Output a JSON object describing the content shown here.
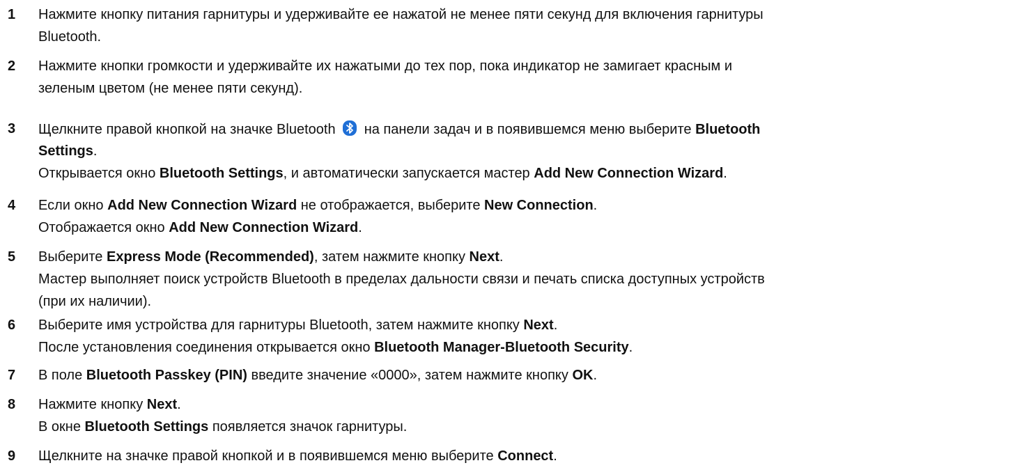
{
  "steps": [
    {
      "num": "1",
      "lines": [
        [
          {
            "t": "Нажмите кнопку питания гарнитуры и удерживайте ее нажатой не менее пяти секунд для включения гарнитуры"
          }
        ],
        [
          {
            "t": "Bluetooth."
          }
        ]
      ]
    },
    {
      "num": "2",
      "lines": [
        [
          {
            "t": "Нажмите кнопки громкости и удерживайте их нажатыми до тех пор, пока индикатор не замигает красным и"
          }
        ],
        [
          {
            "t": "зеленым цветом (не менее пяти секунд)."
          }
        ]
      ]
    },
    {
      "num": "3",
      "lines": [
        [
          {
            "t": "Щелкните правой кнопкой на значке Bluetooth "
          },
          {
            "icon": "bluetooth-icon"
          },
          {
            "t": " на панели задач и в появившемся меню выберите "
          },
          {
            "t": "Bluetooth",
            "b": true
          }
        ],
        [
          {
            "t": "Settings",
            "b": true
          },
          {
            "t": "."
          }
        ],
        [
          {
            "t": "Открывается окно "
          },
          {
            "t": "Bluetooth Settings",
            "b": true
          },
          {
            "t": ", и автоматически запускается мастер "
          },
          {
            "t": "Add New Connection Wizard",
            "b": true
          },
          {
            "t": "."
          }
        ]
      ]
    },
    {
      "num": "4",
      "lines": [
        [
          {
            "t": "Если окно "
          },
          {
            "t": "Add New Connection Wizard",
            "b": true
          },
          {
            "t": " не отображается, выберите "
          },
          {
            "t": "New Connection",
            "b": true
          },
          {
            "t": "."
          }
        ],
        [
          {
            "t": "Отображается окно "
          },
          {
            "t": "Add New Connection Wizard",
            "b": true
          },
          {
            "t": "."
          }
        ]
      ]
    },
    {
      "num": "5",
      "lines": [
        [
          {
            "t": "Выберите "
          },
          {
            "t": "Express Mode (Recommended)",
            "b": true
          },
          {
            "t": ", затем нажмите кнопку "
          },
          {
            "t": "Next",
            "b": true
          },
          {
            "t": "."
          }
        ],
        [
          {
            "t": "Мастер выполняет поиск устройств Bluetooth в пределах дальности связи и печать списка доступных устройств"
          }
        ],
        [
          {
            "t": "(при их наличии)."
          }
        ]
      ]
    },
    {
      "num": "6",
      "lines": [
        [
          {
            "t": "Выберите имя устройства для гарнитуры Bluetooth, затем нажмите кнопку "
          },
          {
            "t": "Next",
            "b": true
          },
          {
            "t": "."
          }
        ],
        [
          {
            "t": "После установления соединения открывается окно "
          },
          {
            "t": "Bluetooth Manager-Bluetooth Security",
            "b": true
          },
          {
            "t": "."
          }
        ]
      ]
    },
    {
      "num": "7",
      "lines": [
        [
          {
            "t": "В поле "
          },
          {
            "t": "Bluetooth Passkey (PIN)",
            "b": true
          },
          {
            "t": " введите значение «0000», затем нажмите кнопку "
          },
          {
            "t": "OK",
            "b": true
          },
          {
            "t": "."
          }
        ]
      ]
    },
    {
      "num": "8",
      "lines": [
        [
          {
            "t": "Нажмите кнопку "
          },
          {
            "t": "Next",
            "b": true
          },
          {
            "t": "."
          }
        ],
        [
          {
            "t": "В окне "
          },
          {
            "t": "Bluetooth Settings",
            "b": true
          },
          {
            "t": " появляется значок гарнитуры."
          }
        ]
      ]
    },
    {
      "num": "9",
      "lines": [
        [
          {
            "t": "Щелкните на значке правой кнопкой и в появившемся меню выберите "
          },
          {
            "t": "Connect",
            "b": true
          },
          {
            "t": "."
          }
        ]
      ]
    }
  ],
  "colors": {
    "text": "#111111",
    "bluetooth_icon_bg": "#1f6fd6"
  }
}
